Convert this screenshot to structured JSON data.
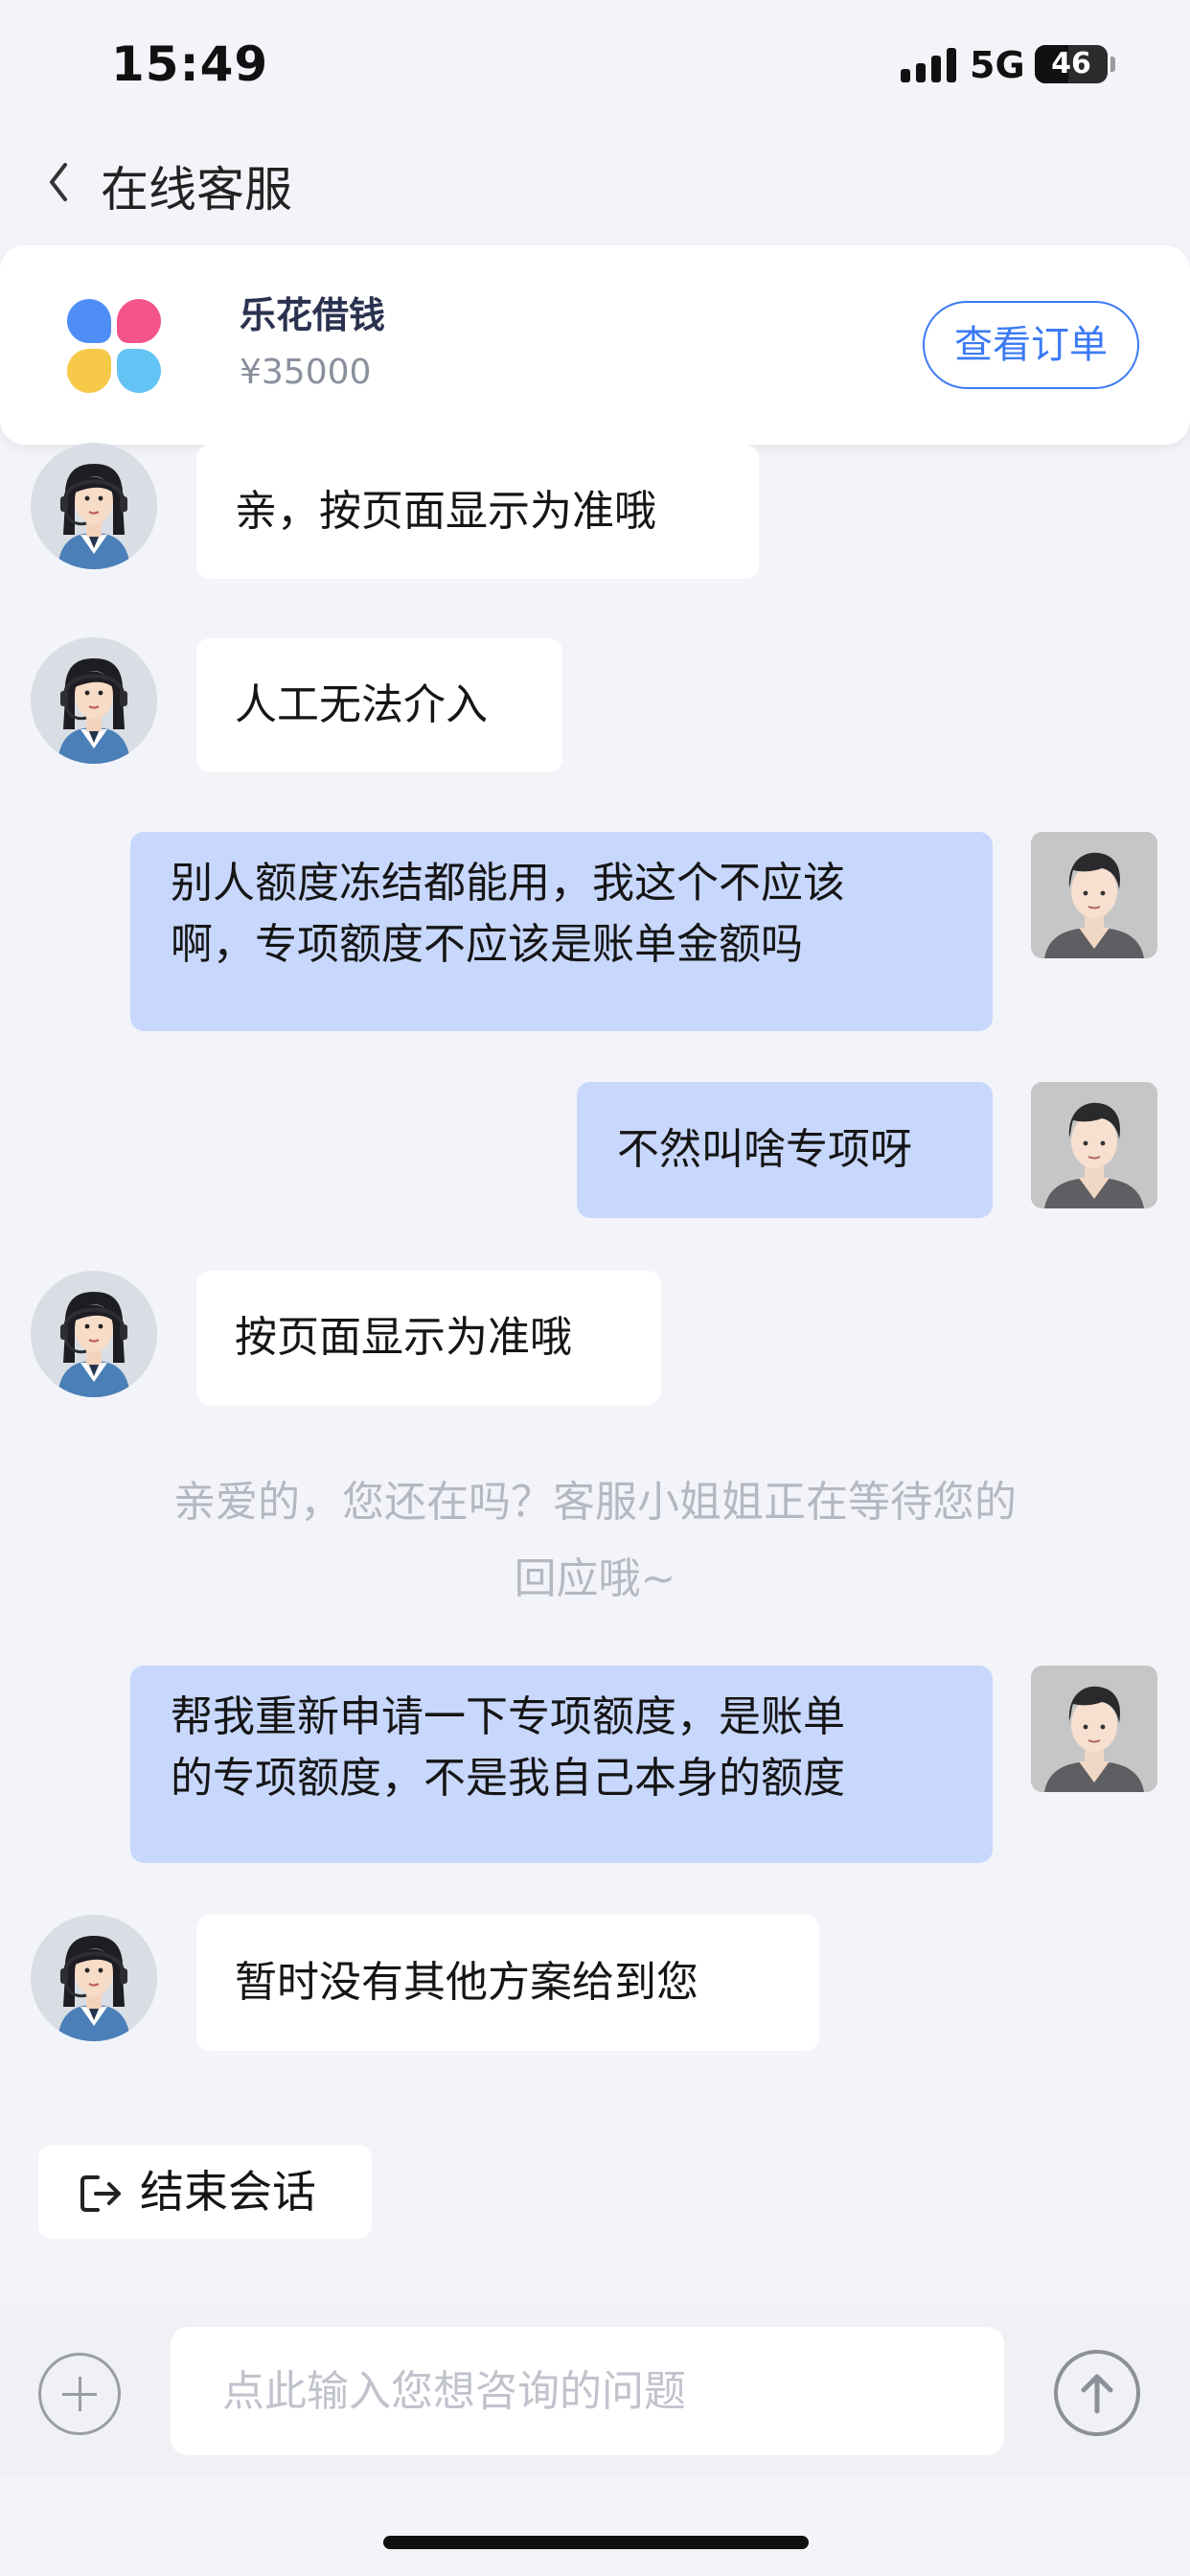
{
  "status_bar": {
    "time": "15:49",
    "network": "5G",
    "battery": "46",
    "battery_level": 0.46
  },
  "header": {
    "title": "在线客服",
    "back_icon": "chevron-left-icon"
  },
  "product_card": {
    "name": "乐花借钱",
    "amount": "¥35000",
    "button_label": "查看订单",
    "accent_color": "#3b7af5"
  },
  "messages": [
    {
      "sender": "agent",
      "text": "亲，按页面显示为准哦"
    },
    {
      "sender": "agent",
      "text": "人工无法介入"
    },
    {
      "sender": "user",
      "lines": [
        "别人额度冻结都能用，我这个不应该",
        "啊，专项额度不应该是账单金额吗"
      ]
    },
    {
      "sender": "user",
      "text": "不然叫啥专项呀"
    },
    {
      "sender": "agent",
      "text": "按页面显示为准哦"
    },
    {
      "sender": "system",
      "lines": [
        "亲爱的，您还在吗？客服小姐姐正在等待您的",
        "回应哦~"
      ]
    },
    {
      "sender": "user",
      "lines": [
        "帮我重新申请一下专项额度，是账单",
        "的专项额度，不是我自己本身的额度"
      ]
    },
    {
      "sender": "agent",
      "text": "暂时没有其他方案给到您"
    }
  ],
  "end_chat": {
    "label": "结束会话",
    "icon": "exit-icon"
  },
  "input_bar": {
    "placeholder": "点此输入您想咨询的问题",
    "value": "",
    "plus_icon": "plus-circle-icon",
    "send_icon": "arrow-up-circle-icon"
  },
  "colors": {
    "background": "#f3f4f9",
    "user_bubble": "#c8d7fc",
    "agent_bubble": "#ffffff",
    "system_text": "#b5b8c2"
  }
}
